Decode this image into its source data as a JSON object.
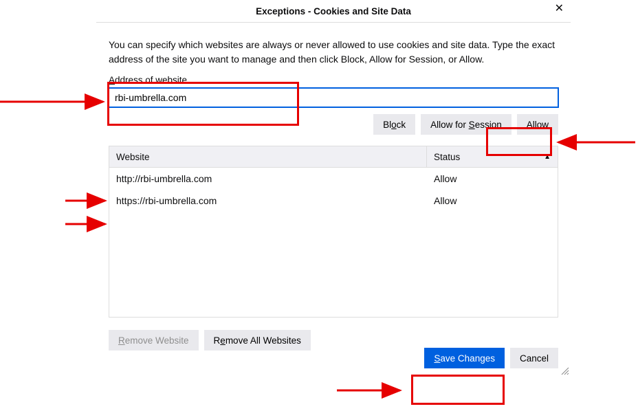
{
  "dialog": {
    "title": "Exceptions - Cookies and Site Data",
    "intro": "You can specify which websites are always or never allowed to use cookies and site data. Type the exact address of the site you want to manage and then click Block, Allow for Session, or Allow.",
    "address_label_pre": "A",
    "address_label_rest": "ddress of website",
    "address_value": "rbi-umbrella.com",
    "buttons": {
      "block": "Bl",
      "block_accel": "o",
      "block_rest": "ck",
      "allow_session_pre": "Allow for ",
      "allow_session_accel": "S",
      "allow_session_rest": "ession",
      "allow_accel": "A",
      "allow_rest": "llow",
      "remove_accel": "R",
      "remove_rest": "emove Website",
      "remove_all_pre": "R",
      "remove_all_accel": "e",
      "remove_all_rest": "move All Websites",
      "save_accel": "S",
      "save_rest": "ave Changes",
      "cancel": "Cancel"
    },
    "table": {
      "header_website": "Website",
      "header_status": "Status",
      "rows": [
        {
          "site": "http://rbi-umbrella.com",
          "status": "Allow"
        },
        {
          "site": "https://rbi-umbrella.com",
          "status": "Allow"
        }
      ]
    }
  }
}
